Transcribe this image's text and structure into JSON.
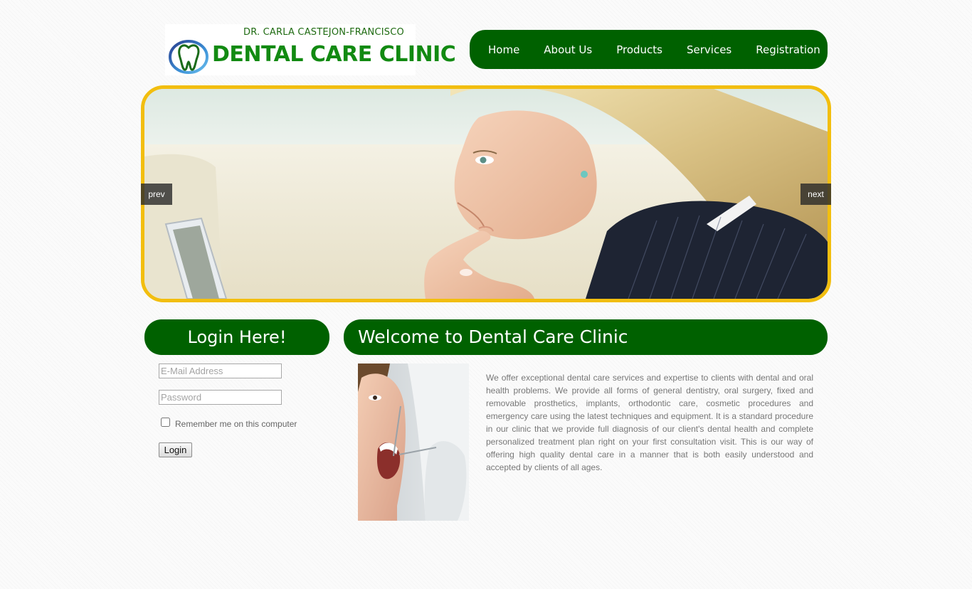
{
  "header": {
    "logo": {
      "doctor_name": "DR. CARLA CASTEJON-FRANCISCO",
      "clinic_name": "DENTAL CARE CLINIC",
      "icon": "tooth-icon"
    },
    "nav": {
      "items": [
        {
          "label": "Home"
        },
        {
          "label": "About Us"
        },
        {
          "label": "Products"
        },
        {
          "label": "Services"
        },
        {
          "label": "Registration"
        }
      ]
    }
  },
  "slider": {
    "prev_label": "prev",
    "next_label": "next",
    "border_color": "#f2be0f"
  },
  "login": {
    "title": "Login Here!",
    "email_placeholder": "E-Mail Address",
    "password_placeholder": "Password",
    "remember_label": "Remember me on this computer",
    "button_label": "Login"
  },
  "welcome": {
    "title": "Welcome to Dental Care Clinic",
    "body": "We offer exceptional dental care services and expertise to clients with dental and oral health problems. We provide all forms of general dentistry, oral surgery, fixed and removable prosthetics, implants, orthodontic care, cosmetic procedures and emergency care using the latest techniques and equipment. It is a standard procedure in our clinic that we provide full diagnosis of our client's dental health and complete personalized treatment plan right on your first consultation visit. This is our way of offering high quality dental care in a manner that is both easily understood and accepted by clients of all ages."
  },
  "colors": {
    "brand_green": "#006100",
    "logo_green": "#128a12",
    "accent_yellow": "#f2be0f",
    "body_text": "#777777"
  }
}
